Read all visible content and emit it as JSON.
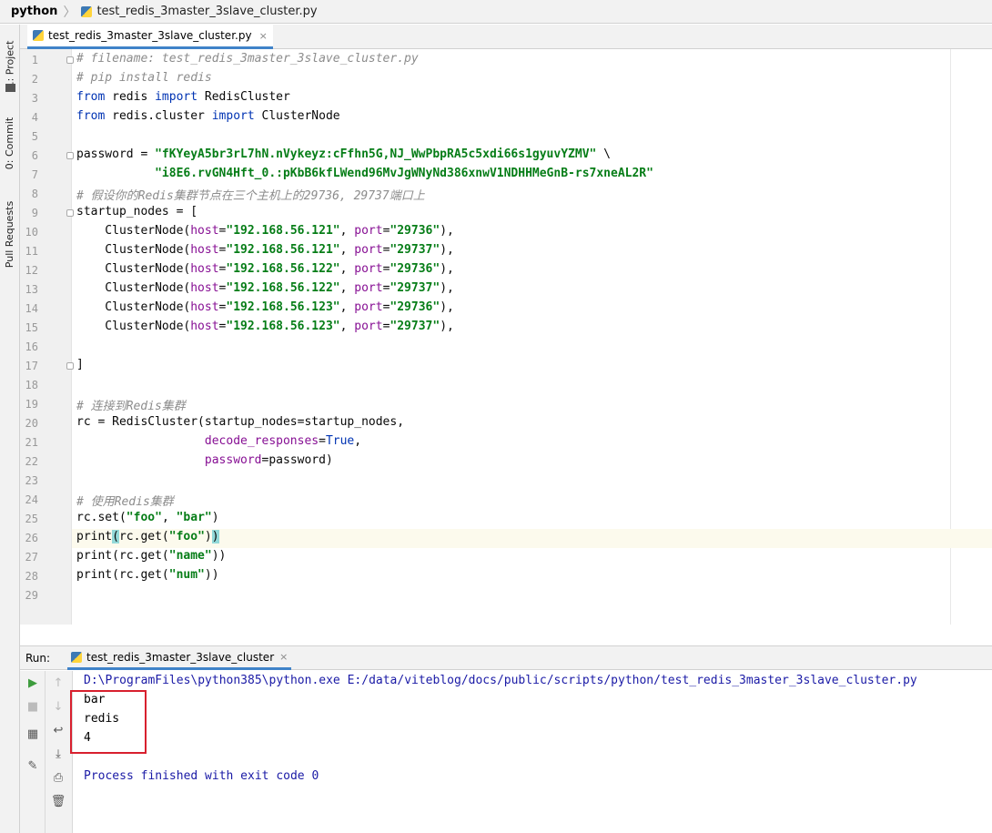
{
  "breadcrumb": {
    "project": "python",
    "file": "test_redis_3master_3slave_cluster.py"
  },
  "side_tabs": {
    "project": "1: Project",
    "commit": "0: Commit",
    "pull": "Pull Requests"
  },
  "editor": {
    "tab_label": "test_redis_3master_3slave_cluster.py",
    "tab_close": "×",
    "current_line": 26,
    "lines": [
      {
        "n": "1",
        "t": "# filename: test_redis_3master_3slave_cluster.py"
      },
      {
        "n": "2",
        "t": "# pip install redis"
      },
      {
        "n": "3",
        "t": "from redis import RedisCluster"
      },
      {
        "n": "4",
        "t": "from redis.cluster import ClusterNode"
      },
      {
        "n": "5",
        "t": ""
      },
      {
        "n": "6",
        "t": "password = \"fKYeyA5br3rL7hN.nVykeyz:cFfhn5G,NJ_WwPbpRA5c5xdi66s1gyuvYZMV\" \\"
      },
      {
        "n": "7",
        "t": "           \"i8E6.rvGN4Hft_0.:pKbB6kfLWend96MvJgWNyNd386xnwV1NDHHMeGnB-rs7xneAL2R\""
      },
      {
        "n": "8",
        "t": "# 假设你的Redis集群节点在三个主机上的29736, 29737端口上"
      },
      {
        "n": "9",
        "t": "startup_nodes = ["
      },
      {
        "n": "10",
        "t": "    ClusterNode(host=\"192.168.56.121\", port=\"29736\"),"
      },
      {
        "n": "11",
        "t": "    ClusterNode(host=\"192.168.56.121\", port=\"29737\"),"
      },
      {
        "n": "12",
        "t": "    ClusterNode(host=\"192.168.56.122\", port=\"29736\"),"
      },
      {
        "n": "13",
        "t": "    ClusterNode(host=\"192.168.56.122\", port=\"29737\"),"
      },
      {
        "n": "14",
        "t": "    ClusterNode(host=\"192.168.56.123\", port=\"29736\"),"
      },
      {
        "n": "15",
        "t": "    ClusterNode(host=\"192.168.56.123\", port=\"29737\"),"
      },
      {
        "n": "16",
        "t": ""
      },
      {
        "n": "17",
        "t": "]"
      },
      {
        "n": "18",
        "t": ""
      },
      {
        "n": "19",
        "t": "# 连接到Redis集群"
      },
      {
        "n": "20",
        "t": "rc = RedisCluster(startup_nodes=startup_nodes,"
      },
      {
        "n": "21",
        "t": "                  decode_responses=True,"
      },
      {
        "n": "22",
        "t": "                  password=password)"
      },
      {
        "n": "23",
        "t": ""
      },
      {
        "n": "24",
        "t": "# 使用Redis集群"
      },
      {
        "n": "25",
        "t": "rc.set(\"foo\", \"bar\")"
      },
      {
        "n": "26",
        "t": "print(rc.get(\"foo\"))"
      },
      {
        "n": "27",
        "t": "print(rc.get(\"name\"))"
      },
      {
        "n": "28",
        "t": "print(rc.get(\"num\"))"
      },
      {
        "n": "29",
        "t": ""
      }
    ]
  },
  "run": {
    "label": "Run:",
    "tab_label": "test_redis_3master_3slave_cluster",
    "tab_close": "×",
    "output": [
      "D:\\ProgramFiles\\python385\\python.exe E:/data/viteblog/docs/public/scripts/python/test_redis_3master_3slave_cluster.py",
      "bar",
      "redis",
      "4",
      "",
      "Process finished with exit code 0"
    ]
  }
}
